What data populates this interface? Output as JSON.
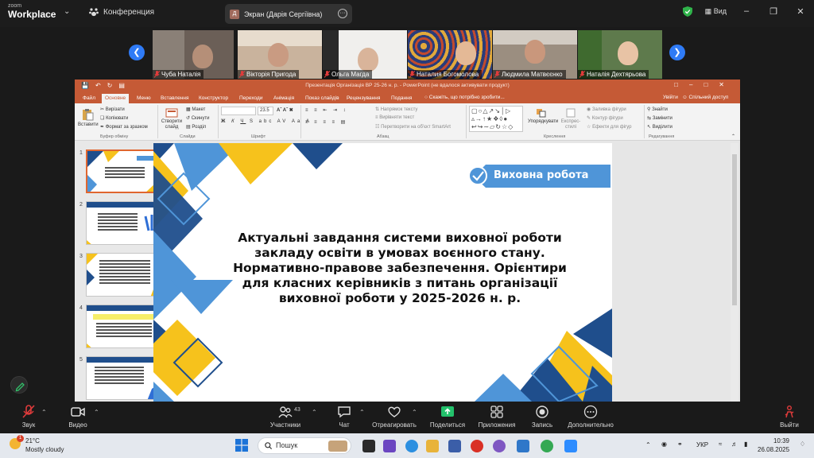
{
  "zoom": {
    "brand_top": "zoom",
    "brand_bottom": "Workplace",
    "menu_label": "Конференция",
    "share_tab_letter": "Д",
    "share_tab_label": "Экран (Дарія Сергіївна)",
    "view_label": "Вид",
    "participants": [
      "Чуба Наталія",
      "Вікторія Пригода",
      "Ольга Магда",
      "Наталия Богомолова",
      "Людмила Матвєєнко",
      "Наталія Дехтярьова"
    ],
    "controls": {
      "audio": "Звук",
      "video": "Видео",
      "participants": "Участники",
      "participants_count": "43",
      "chat": "Чат",
      "react": "Отреагировать",
      "share": "Поделиться",
      "apps": "Приложения",
      "record": "Запись",
      "more": "Дополнительно",
      "leave": "Выйти"
    }
  },
  "ppt": {
    "title": "Презентація Організація ВР 25-26 н. р. - PowerPoint (не вдалося активувати продукт)",
    "tabs": [
      "Файл",
      "Основне",
      "Меню",
      "Вставлення",
      "Конструктор",
      "Переходи",
      "Анімація",
      "Показ слайдів",
      "Рецензування",
      "Подання"
    ],
    "tell_me": "Скажіть, що потрібно зробити...",
    "sign_in": "Увійти",
    "share": "Спільний доступ",
    "ribbon": {
      "paste": "Вставити",
      "cut": "Вирізати",
      "copy": "Копіювати",
      "format_painter": "Формат за зразком",
      "clipboard": "Буфер обміну",
      "new_slide": "Створити слайд",
      "layout": "Макет",
      "reset": "Скинути",
      "section": "Розділ",
      "slides": "Слайди",
      "font_size": "23.5",
      "font": "Шрифт",
      "text_direction": "Напрямок тексту",
      "align_text": "Вирівняти текст",
      "smartart": "Перетворити на об'єкт SmartArt",
      "paragraph": "Абзац",
      "arrange": "Упорядкувати",
      "quick_styles": "Експрес-стилі",
      "shape_fill": "Заливка фігури",
      "shape_outline": "Контур фігури",
      "shape_effects": "Ефекти для фігур",
      "drawing": "Креслення",
      "find": "Знайти",
      "replace": "Замінити",
      "select": "Виділити",
      "editing": "Редагування"
    },
    "thumb_numbers": [
      "1",
      "2",
      "3",
      "4",
      "5"
    ],
    "slide": {
      "banner": "Виховна робота",
      "title": "Актуальні завдання системи виховної роботи закладу освіти в умовах воєнного стану. Нормативно-правове забезпечення. Орієнтири для класних керівників з питань організації виховної роботи у 2025-2026 н. р."
    }
  },
  "taskbar": {
    "temp": "21°C",
    "weather": "Mostly cloudy",
    "search": "Пошук",
    "lang": "УКР",
    "time": "10:39",
    "date": "26.08.2025",
    "notif": "1"
  },
  "colors": {
    "ppt_accent": "#c55a36",
    "zoom_blue": "#2f7bf6",
    "slide_blue": "#1f4e8c",
    "slide_yellow": "#f6c21c",
    "slide_light_blue": "#4f95d8"
  }
}
